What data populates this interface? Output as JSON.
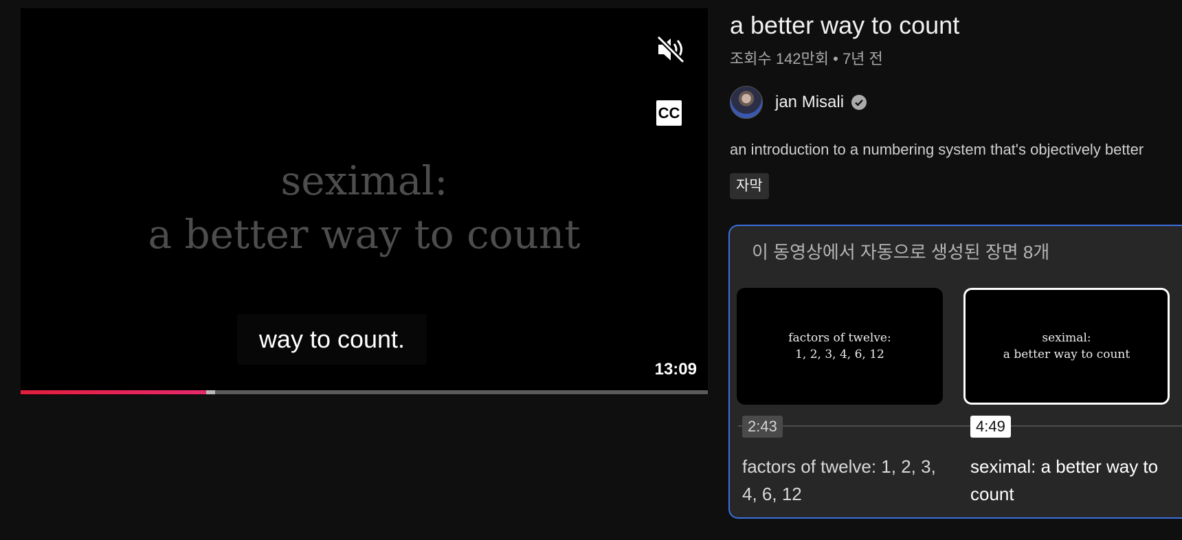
{
  "player": {
    "frame_line1": "seximal:",
    "frame_line2": "a better way to count",
    "caption": "way to count.",
    "duration": "13:09",
    "cc_label": "CC",
    "progress": {
      "played": 0.27,
      "buffered_to": 0.283
    },
    "accent_color": "#e01f3d"
  },
  "video": {
    "title": "a better way to count",
    "meta": "조회수 142만회 • 7년 전",
    "channel_name": "jan Misali",
    "description": "an introduction to a numbering system that's objectively better",
    "chip": "자막"
  },
  "chapters": {
    "header": "이 동영상에서 자동으로 생성된 장면 8개",
    "border_color": "#3d6fe0",
    "items": [
      {
        "thumb_line1": "factors of twelve:",
        "thumb_line2": "1, 2, 3, 4, 6, 12",
        "timestamp": "2:43",
        "title": "factors of twelve: 1, 2, 3, 4, 6, 12",
        "active": false
      },
      {
        "thumb_line1": "seximal:",
        "thumb_line2": "a better way to count",
        "timestamp": "4:49",
        "title": "seximal: a better way to count",
        "active": true
      }
    ]
  },
  "icons": [
    "volume-muted-icon",
    "closed-captions-icon",
    "verified-check-icon"
  ]
}
